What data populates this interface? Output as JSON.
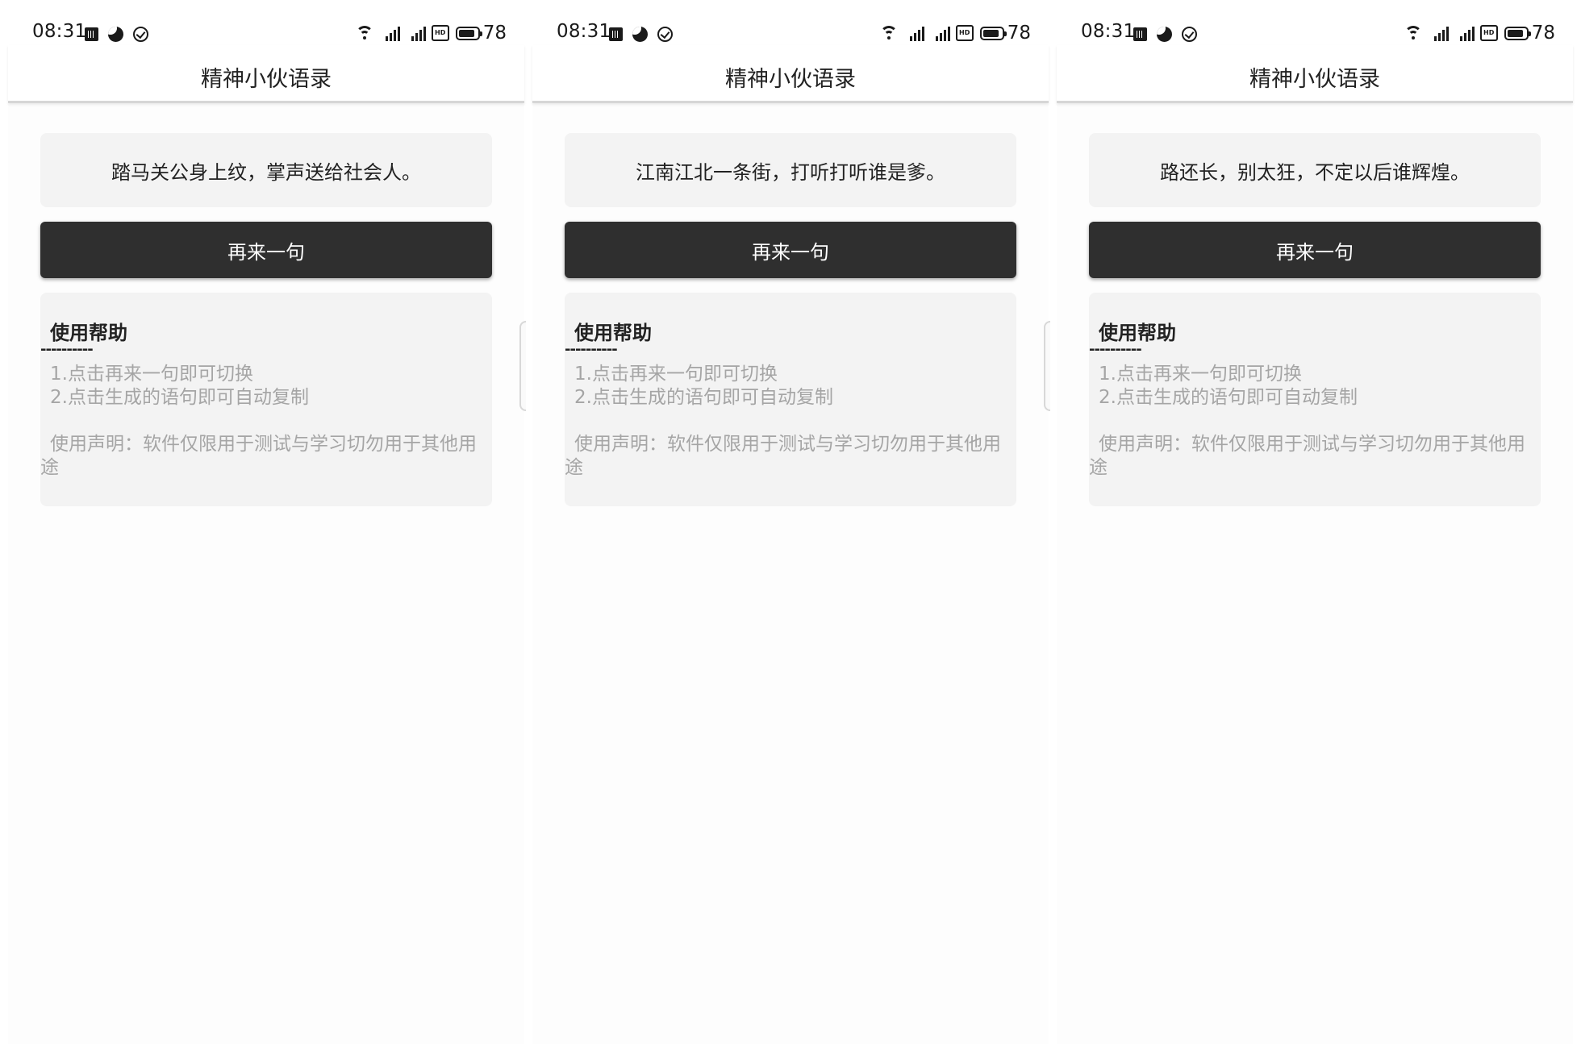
{
  "status_bar": {
    "time": "08:31",
    "battery_level": "78",
    "left_icons": [
      "notification-grid-icon",
      "moon-icon",
      "check-circle-icon"
    ],
    "right_icons": [
      "wifi-icon",
      "signal-icon",
      "signal-icon",
      "hd-icon",
      "battery-icon"
    ]
  },
  "app": {
    "title": "精神小伙语录",
    "next_button_label": "再来一句"
  },
  "help": {
    "title": "使用帮助",
    "divider": "----------",
    "lines": [
      "1.点击再来一句即可切换",
      "2.点击生成的语句即可自动复制"
    ],
    "disclaimer": "使用声明：软件仅限用于测试与学习切勿用于其他用途"
  },
  "screens": [
    {
      "quote": "踏马关公身上纹，掌声送给社会人。"
    },
    {
      "quote": "江南江北一条街，打听打听谁是爹。"
    },
    {
      "quote": "路还长，别太狂，不定以后谁辉煌。"
    }
  ],
  "colors": {
    "button_bg": "#2f2f2f",
    "card_bg": "#f3f3f3",
    "help_text": "#a5a5a5"
  }
}
